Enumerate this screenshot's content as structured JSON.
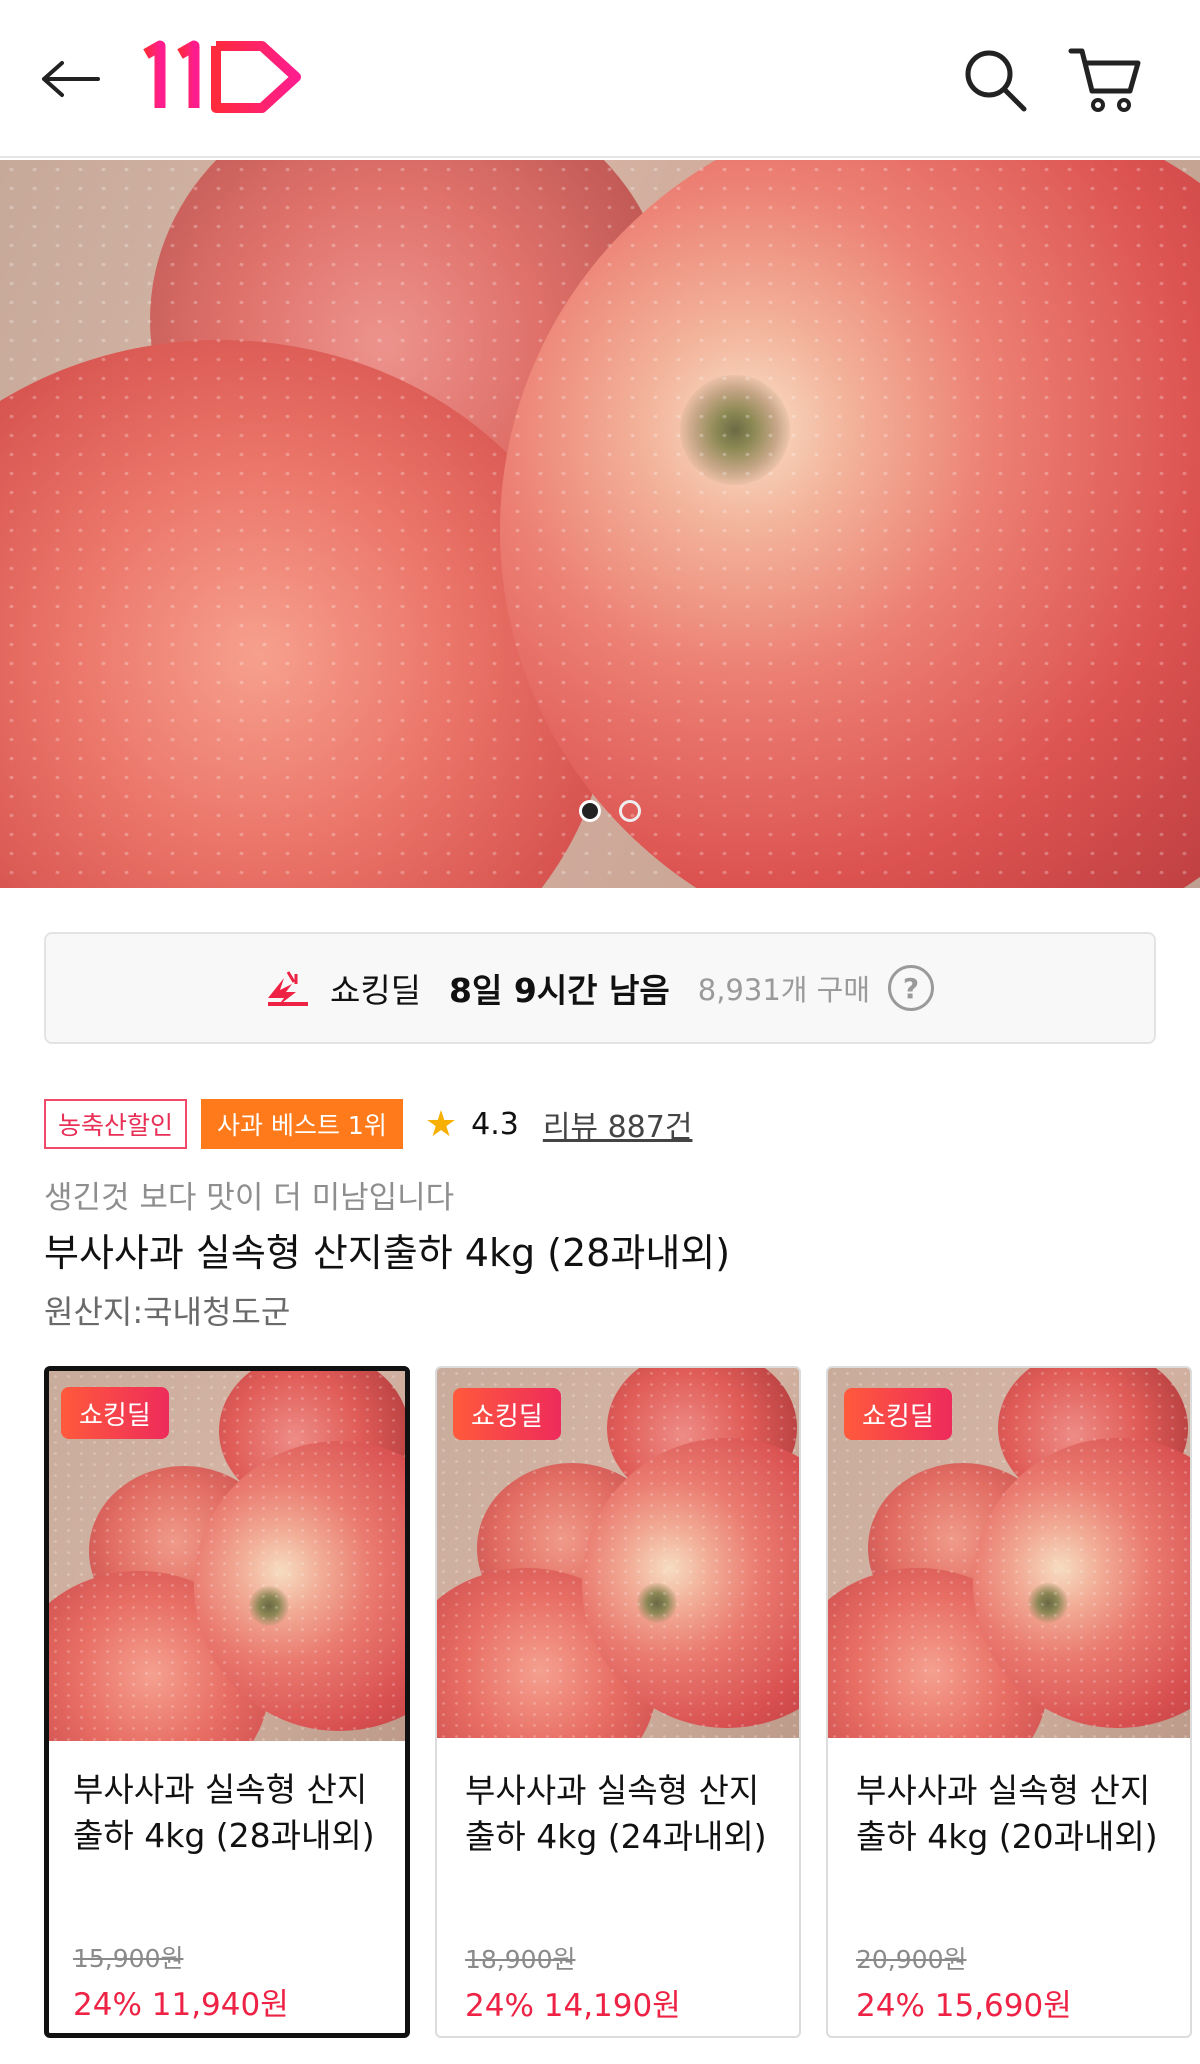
{
  "header": {
    "logo_text": "11",
    "brand_color": "#ff1459"
  },
  "hero": {
    "slide_count": 2,
    "active_slide": 1
  },
  "deal_bar": {
    "label": "쇼킹딜",
    "time_left": "8일 9시간 남음",
    "purchase_count": "8,931개 구매",
    "help": "?"
  },
  "badges": {
    "category": "농축산할인",
    "rank": "사과 베스트 1위"
  },
  "rating": {
    "star": "★",
    "score": "4.3",
    "review": "리뷰 887건"
  },
  "product": {
    "subtitle": "생긴것 보다 맛이 더 미남입니다",
    "title": "부사사과 실속형 산지출하 4kg (28과내외)",
    "origin": "원산지:국내청도군"
  },
  "options": [
    {
      "badge": "쇼킹딜",
      "title": "부사사과 실속형 산지출하 4kg (28과내외)",
      "original_price": "15,900원",
      "sale_price": "24% 11,940원",
      "selected": true
    },
    {
      "badge": "쇼킹딜",
      "title": "부사사과 실속형 산지출하 4kg (24과내외)",
      "original_price": "18,900원",
      "sale_price": "24% 14,190원",
      "selected": false
    },
    {
      "badge": "쇼킹딜",
      "title": "부사사과 실속형 산지출하 4kg (20과내외)",
      "original_price": "20,900원",
      "sale_price": "24% 15,690원",
      "selected": false
    }
  ],
  "colors": {
    "sale_red": "#ee2244",
    "badge_orange": "#ff7a1a",
    "star_yellow": "#f8b000"
  }
}
